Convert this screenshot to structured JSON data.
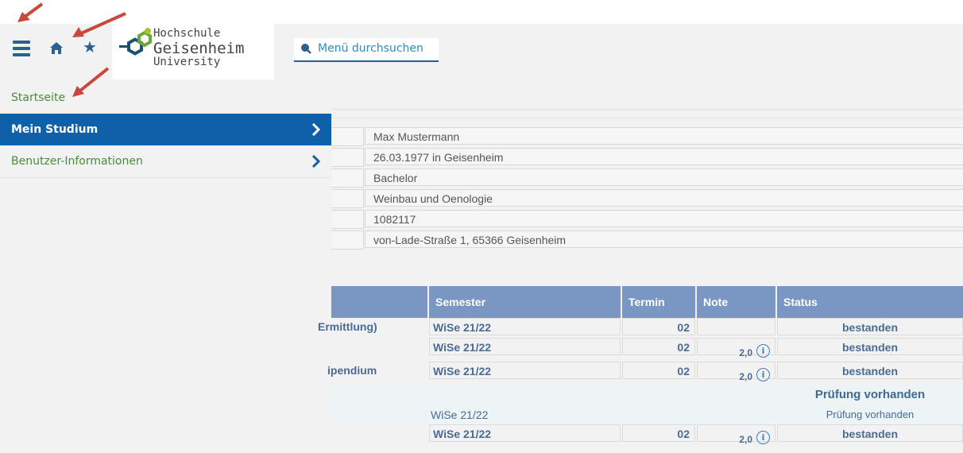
{
  "toolbar": {
    "menu_icon": "hamburger-icon",
    "home_icon": "home-icon",
    "favorites_icon": "star-icon",
    "colors": {
      "accent": "#2d5f92",
      "active_menu": "#0e60a8"
    }
  },
  "logo": {
    "line1": "Hochschule",
    "line2": "Geisenheim",
    "line3": "University"
  },
  "search": {
    "placeholder": "Menü durchsuchen"
  },
  "menu": {
    "items": [
      {
        "label": "Startseite"
      },
      {
        "label": "Mein Studium"
      },
      {
        "label": "Benutzer-Informationen"
      }
    ]
  },
  "student": {
    "name": "Max Mustermann",
    "birth": "26.03.1977 in Geisenheim",
    "degree": "Bachelor",
    "program": "Weinbau und Oenologie",
    "matriculation": "1082117",
    "address": "von-Lade-Straße 1, 65366 Geisenheim"
  },
  "results": {
    "headers": {
      "semester": "Semester",
      "termin": "Termin",
      "note": "Note",
      "status": "Status"
    },
    "rows": [
      {
        "title": "Ermittlung)",
        "semester": "WiSe 21/22",
        "termin": "02",
        "note": "",
        "status": "bestanden"
      },
      {
        "title": "",
        "semester": "WiSe 21/22",
        "termin": "02",
        "note": "2,0",
        "status": "bestanden"
      },
      {
        "title": "ipendium",
        "semester": "WiSe 21/22",
        "termin": "02",
        "note": "2,0",
        "status": "bestanden"
      },
      {
        "title": "",
        "semester": "",
        "termin": "",
        "note": "",
        "status": "Prüfung vorhanden"
      },
      {
        "title": "",
        "semester": "WiSe 21/22",
        "termin": "",
        "note": "",
        "status": "Prüfung vorhanden"
      },
      {
        "title": "",
        "semester": "WiSe 21/22",
        "termin": "02",
        "note": "2,0",
        "status": "bestanden"
      }
    ]
  }
}
